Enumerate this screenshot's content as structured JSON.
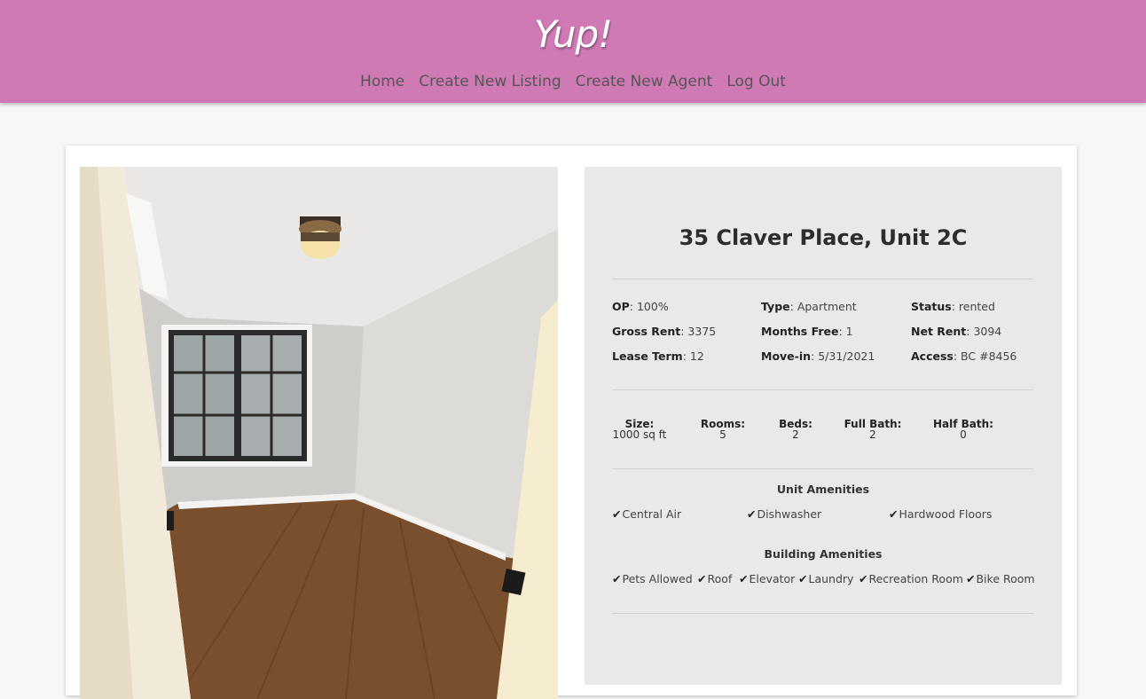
{
  "header": {
    "brand": "Yup!",
    "nav": [
      "Home",
      "Create New Listing",
      "Create New Agent",
      "Log Out"
    ],
    "bg_color": "#cf7ab5"
  },
  "listing": {
    "address": "35 Claver Place, Unit 2C",
    "fields": [
      {
        "label": "OP",
        "value": "100%"
      },
      {
        "label": "Type",
        "value": "Apartment"
      },
      {
        "label": "Status",
        "value": "rented"
      },
      {
        "label": "Gross Rent",
        "value": "3375"
      },
      {
        "label": "Months Free",
        "value": "1"
      },
      {
        "label": "Net Rent",
        "value": "3094"
      },
      {
        "label": "Lease Term",
        "value": "12"
      },
      {
        "label": "Move-in",
        "value": "5/31/2021"
      },
      {
        "label": "Access",
        "value": "BC #8456"
      }
    ],
    "stats": [
      {
        "label": "Size:",
        "value": "1000 sq ft"
      },
      {
        "label": "Rooms:",
        "value": "5"
      },
      {
        "label": "Beds:",
        "value": "2"
      },
      {
        "label": "Full Bath:",
        "value": "2"
      },
      {
        "label": "Half Bath:",
        "value": "0"
      }
    ],
    "unit_amenities_title": "Unit Amenities",
    "unit_amenities": [
      "Central Air",
      "Dishwasher",
      "Hardwood Floors"
    ],
    "building_amenities_title": "Building Amenities",
    "building_amenities": [
      "Pets Allowed",
      "Roof",
      "Elevator",
      "Laundry",
      "Recreation Room",
      "Bike Room"
    ],
    "check_icon": "checkmark-icon"
  }
}
